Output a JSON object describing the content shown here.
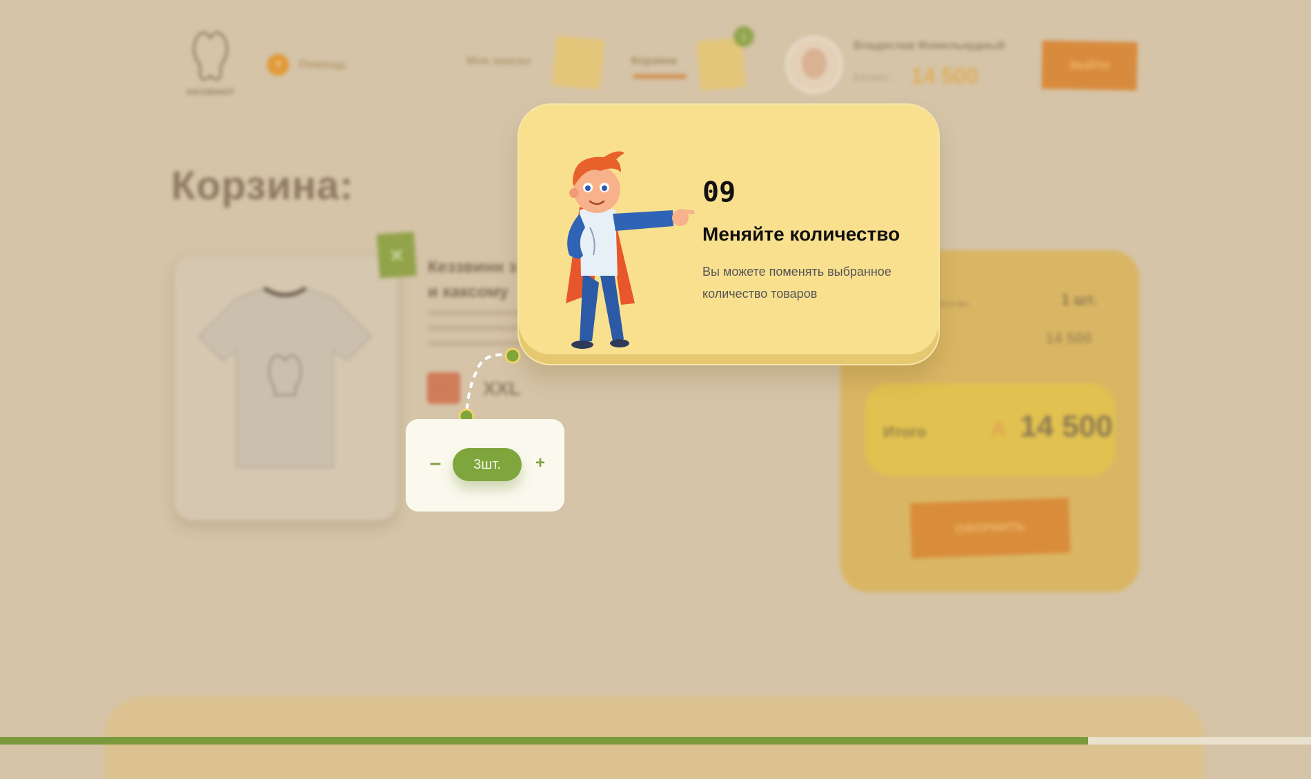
{
  "header": {
    "logo_text": "КАССЕНАОТ",
    "help_badge": "?",
    "help_label": "Помощь",
    "nav_orders": "Мои заказы",
    "nav_cart": "Корзина",
    "cart_count": "1",
    "user_name": "Владислав Фомельнрдный",
    "balance_label": "Баланс:",
    "balance_value": "14 500",
    "logout_label": "ВЫЙТИ"
  },
  "cart": {
    "title": "Корзина:",
    "product": {
      "name_line1": "Кеззвинн з",
      "name_line2": "и каксому",
      "size": "XXL",
      "remove_icon": "×"
    },
    "summary": {
      "qty_label": "Кол-во",
      "qty_value": "1 шт.",
      "price_value": "14 500",
      "total_label": "Итого",
      "total_sign": "А",
      "total_value": "14 500",
      "checkout_label": "ОФОРМИТЬ"
    }
  },
  "tutorial": {
    "step": "09",
    "title": "Меняйте количество",
    "text": "Вы можете поменять выбранное количество товаров"
  },
  "quantity": {
    "minus": "–",
    "value": "3шт.",
    "plus": "+"
  },
  "progress": {
    "fraction": 0.83
  },
  "colors": {
    "accent_green": "#7ea63d",
    "tooltip_yellow": "#f9e08f",
    "background": "#d5c4a8"
  }
}
